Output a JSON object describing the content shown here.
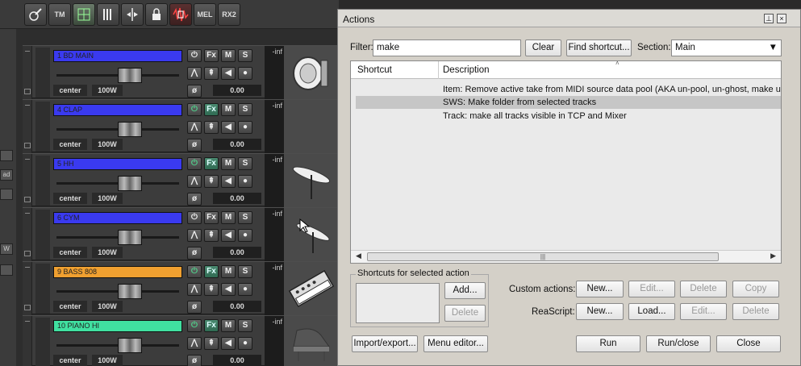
{
  "toolbar": {
    "buttons": [
      {
        "label": "",
        "icon": "guitar-icon"
      },
      {
        "label": "TM",
        "icon": ""
      },
      {
        "label": "",
        "icon": "grid-icon"
      },
      {
        "label": "",
        "icon": "bars-icon"
      },
      {
        "label": "",
        "icon": "split-icon"
      },
      {
        "label": "",
        "icon": "lock-icon"
      },
      {
        "label": "",
        "icon": "waveform-icon"
      },
      {
        "label": "MEL",
        "icon": ""
      },
      {
        "label": "RX2",
        "icon": ""
      }
    ]
  },
  "left_strip": {
    "items": [
      "",
      "ad",
      "",
      "W",
      ""
    ]
  },
  "tracks": [
    {
      "name": "1   BD MAIN",
      "color": "#3a3af0",
      "pan": "center",
      "width": "100W",
      "volume": "0.00",
      "meter": "-inf",
      "fx_active": false,
      "image": "bass-drum-icon"
    },
    {
      "name": "4   CLAP",
      "color": "#3a3af0",
      "pan": "center",
      "width": "100W",
      "volume": "0.00",
      "meter": "-inf",
      "fx_active": true,
      "image": ""
    },
    {
      "name": "5   HH",
      "color": "#3a3af0",
      "pan": "center",
      "width": "100W",
      "volume": "0.00",
      "meter": "-inf",
      "fx_active": true,
      "image": "cymbal-icon"
    },
    {
      "name": "6   CYM",
      "color": "#3a3af0",
      "pan": "center",
      "width": "100W",
      "volume": "0.00",
      "meter": "-inf",
      "fx_active": false,
      "image": "cymbal-icon"
    },
    {
      "name": "9   BASS 808",
      "color": "#f0a030",
      "pan": "center",
      "width": "100W",
      "volume": "0.00",
      "meter": "-inf",
      "fx_active": true,
      "image": "synth-icon"
    },
    {
      "name": "10  PIANO HI",
      "color": "#40e0a0",
      "pan": "center",
      "width": "100W",
      "volume": "0.00",
      "meter": "-inf",
      "fx_active": true,
      "image": "piano-icon"
    }
  ],
  "track_buttons": {
    "fx": "Fx",
    "mute": "M",
    "solo": "S"
  },
  "dialog": {
    "title": "Actions",
    "filter_label": "Filter:",
    "filter_value": "make",
    "clear_label": "Clear",
    "find_shortcut_label": "Find shortcut...",
    "section_label": "Section:",
    "section_value": "Main",
    "columns": [
      "Shortcut",
      "Description"
    ],
    "rows": [
      {
        "shortcut": "",
        "description": "Item: Remove active take from MIDI source data pool (AKA un-pool, un-ghost, make unic",
        "selected": false
      },
      {
        "shortcut": "",
        "description": "SWS: Make folder from selected tracks",
        "selected": true
      },
      {
        "shortcut": "",
        "description": "Track: make all tracks visible in TCP and Mixer",
        "selected": false
      }
    ],
    "shortcuts_group_label": "Shortcuts for selected action",
    "add_label": "Add...",
    "delete_label": "Delete",
    "custom_actions_label": "Custom actions:",
    "reascript_label": "ReaScript:",
    "custom_new": "New...",
    "custom_edit": "Edit...",
    "custom_delete": "Delete",
    "custom_copy": "Copy",
    "reascript_new": "New...",
    "reascript_load": "Load...",
    "reascript_edit": "Edit...",
    "reascript_delete": "Delete",
    "import_export_label": "Import/export...",
    "menu_editor_label": "Menu editor...",
    "run_label": "Run",
    "run_close_label": "Run/close",
    "close_label": "Close"
  }
}
